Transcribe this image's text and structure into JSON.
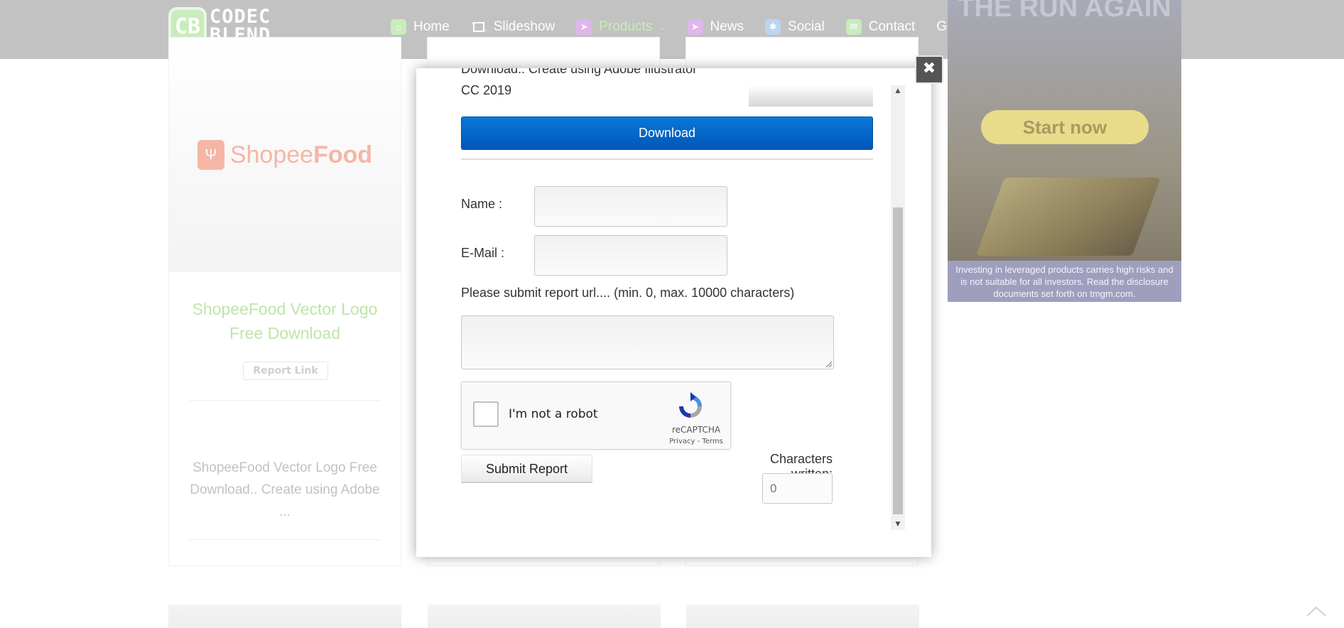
{
  "header": {
    "logo_badge": "CB",
    "logo_text": "CODEC\nBLEND",
    "nav": [
      {
        "label": "Home",
        "icon": "home-icon",
        "color": "#c9ecbd"
      },
      {
        "label": "Slideshow",
        "icon": "slideshow-icon",
        "color": "transparent"
      },
      {
        "label": "Products",
        "icon": "send-icon",
        "color": "#e0b6ec",
        "active": true
      },
      {
        "label": "News",
        "icon": "send-icon",
        "color": "#e0b6ec"
      },
      {
        "label": "Social",
        "icon": "social-icon",
        "color": "#bcd4f0"
      },
      {
        "label": "Contact",
        "icon": "mail-icon",
        "color": "#c9ecbd"
      },
      {
        "label": "GDPR",
        "icon": "",
        "color": "transparent"
      }
    ]
  },
  "card": {
    "image_brand_plain": "Shopee",
    "image_brand_bold": "Food",
    "title": "ShopeeFood Vector Logo Free Download",
    "report_link": "Report Link",
    "description": "ShopeeFood Vector Logo Free Download.. Create using Adobe ..."
  },
  "ad": {
    "headline": "THE RUN AGAIN",
    "button": "Start now",
    "disclaimer": "Investing in leveraged products carries high risks and is not suitable for all investors. Read the disclosure documents set forth on tmgm.com."
  },
  "modal": {
    "close_glyph": "✖",
    "partial_text": "Download.. Create using Adobe Illustrator CC 2019",
    "download_label": "Download",
    "name_label": "Name :",
    "email_label": "E-Mail :",
    "name_value": "",
    "email_value": "",
    "report_hint": "Please submit report url.... (min. 0, max. 10000 characters)",
    "report_value": "",
    "recaptcha_label": "I'm not a robot",
    "recaptcha_brand": "reCAPTCHA",
    "recaptcha_terms": "Privacy - Terms",
    "submit_label": "Submit Report",
    "chars_label": "Characters written:",
    "chars_value": "0"
  },
  "colors": {
    "header_bg": "#c2c2c2",
    "download_blue": "#0067c8",
    "title_green": "#bfe5a9"
  }
}
